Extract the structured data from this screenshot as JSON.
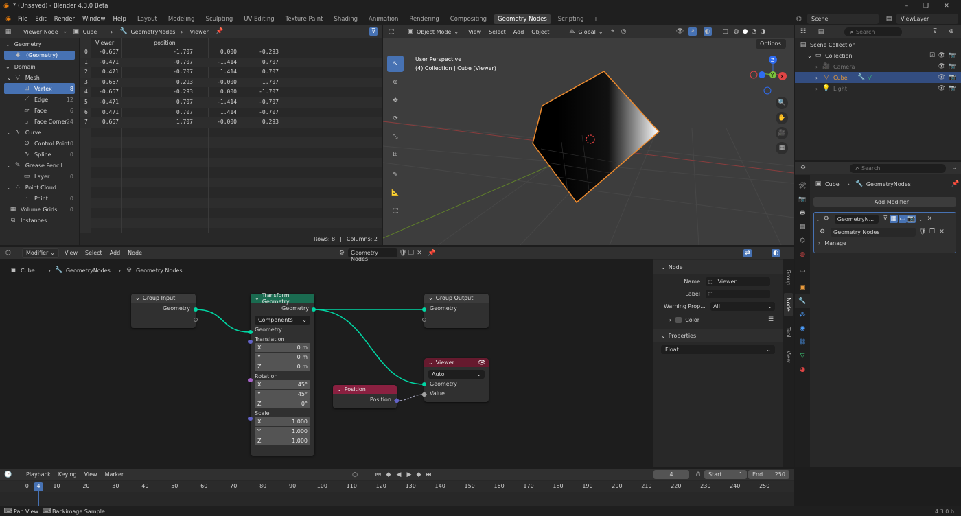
{
  "titlebar": {
    "title": "* (Unsaved) - Blender 4.3.0 Beta"
  },
  "menubar": {
    "items": [
      "File",
      "Edit",
      "Render",
      "Window",
      "Help"
    ],
    "workspaces": [
      "Layout",
      "Modeling",
      "Sculpting",
      "UV Editing",
      "Texture Paint",
      "Shading",
      "Animation",
      "Rendering",
      "Compositing",
      "Geometry Nodes",
      "Scripting"
    ],
    "active_workspace": "Geometry Nodes",
    "add": "+",
    "scene": "Scene",
    "view_layer": "ViewLayer"
  },
  "spreadsheet": {
    "mode": "Viewer Node",
    "object": "Cube",
    "modifier": "GeometryNodes",
    "viewer": "Viewer",
    "geometry_label": "Geometry",
    "geometry_item": "(Geometry)",
    "domain_label": "Domain",
    "domains": [
      {
        "label": "Mesh",
        "count": ""
      },
      {
        "label": "Vertex",
        "count": "8"
      },
      {
        "label": "Edge",
        "count": "12"
      },
      {
        "label": "Face",
        "count": "6"
      },
      {
        "label": "Face Corner",
        "count": "24"
      },
      {
        "label": "Curve",
        "count": ""
      },
      {
        "label": "Control Point",
        "count": "0"
      },
      {
        "label": "Spline",
        "count": "0"
      },
      {
        "label": "Grease Pencil",
        "count": ""
      },
      {
        "label": "Layer",
        "count": "0"
      },
      {
        "label": "Point Cloud",
        "count": ""
      },
      {
        "label": "Point",
        "count": "0"
      },
      {
        "label": "Volume Grids",
        "count": "0"
      },
      {
        "label": "Instances",
        "count": ""
      }
    ],
    "col_viewer": "Viewer",
    "col_position": "position",
    "rows": [
      {
        "i": "0",
        "v": "-0.667",
        "x": "-1.707",
        "y": "0.000",
        "z": "-0.293"
      },
      {
        "i": "1",
        "v": "-0.471",
        "x": "-0.707",
        "y": "-1.414",
        "z": "0.707"
      },
      {
        "i": "2",
        "v": "0.471",
        "x": "-0.707",
        "y": "1.414",
        "z": "0.707"
      },
      {
        "i": "3",
        "v": "0.667",
        "x": "0.293",
        "y": "-0.000",
        "z": "1.707"
      },
      {
        "i": "4",
        "v": "-0.667",
        "x": "-0.293",
        "y": "0.000",
        "z": "-1.707"
      },
      {
        "i": "5",
        "v": "-0.471",
        "x": "0.707",
        "y": "-1.414",
        "z": "-0.707"
      },
      {
        "i": "6",
        "v": "0.471",
        "x": "0.707",
        "y": "1.414",
        "z": "-0.707"
      },
      {
        "i": "7",
        "v": "0.667",
        "x": "1.707",
        "y": "-0.000",
        "z": "0.293"
      }
    ],
    "rows_status": "Rows: 8",
    "cols_status": "Columns: 2"
  },
  "viewport": {
    "mode": "Object Mode",
    "menus": [
      "View",
      "Select",
      "Add",
      "Object"
    ],
    "orientation": "Global",
    "options": "Options",
    "line1": "User Perspective",
    "line2": "(4) Collection | Cube (Viewer)",
    "gizmo": {
      "x": "X",
      "y": "Y",
      "z": "Z"
    }
  },
  "outliner": {
    "search_placeholder": "Search",
    "items": [
      {
        "label": "Scene Collection"
      },
      {
        "label": "Collection"
      },
      {
        "label": "Camera"
      },
      {
        "label": "Cube"
      },
      {
        "label": "Light"
      }
    ]
  },
  "properties": {
    "search_placeholder": "Search",
    "obj": "Cube",
    "mod": "GeometryNodes",
    "add_modifier": "Add Modifier",
    "modifier_name": "GeometryN...",
    "node_group": "Geometry Nodes",
    "manage": "Manage"
  },
  "node_editor": {
    "type": "Modifier",
    "menus": [
      "View",
      "Select",
      "Add",
      "Node"
    ],
    "group": "Geometry Nodes",
    "breadcrumb": [
      "Cube",
      "GeometryNodes",
      "Geometry Nodes"
    ],
    "nodes": {
      "group_input": {
        "title": "Group Input",
        "out": "Geometry"
      },
      "transform": {
        "title": "Transform Geometry",
        "out": "Geometry",
        "mode": "Components",
        "in_geo": "Geometry",
        "translation": "Translation",
        "tx": "0 m",
        "ty": "0 m",
        "tz": "0 m",
        "rotation": "Rotation",
        "rx": "45°",
        "ry": "45°",
        "rz": "0°",
        "scale": "Scale",
        "sx": "1.000",
        "sy": "1.000",
        "sz": "1.000",
        "X": "X",
        "Y": "Y",
        "Z": "Z"
      },
      "group_output": {
        "title": "Group Output",
        "in": "Geometry"
      },
      "viewer": {
        "title": "Viewer",
        "domain": "Auto",
        "in_geo": "Geometry",
        "in_val": "Value"
      },
      "position": {
        "title": "Position",
        "out": "Position"
      }
    },
    "sidebar": {
      "node_header": "Node",
      "name_label": "Name",
      "name_value": "Viewer",
      "label_label": "Label",
      "label_value": "",
      "warning_label": "Warning Prop...",
      "warning_value": "All",
      "color_label": "Color",
      "properties_header": "Properties",
      "type_value": "Float",
      "tabs": [
        "Group",
        "Node",
        "Tool",
        "View"
      ]
    }
  },
  "timeline": {
    "menus": [
      "Playback",
      "Keying",
      "View",
      "Marker"
    ],
    "current": "4",
    "start_label": "Start",
    "start": "1",
    "end_label": "End",
    "end": "250",
    "ticks": [
      "0",
      "10",
      "20",
      "30",
      "40",
      "50",
      "60",
      "70",
      "80",
      "90",
      "100",
      "110",
      "120",
      "130",
      "140",
      "150",
      "160",
      "170",
      "180",
      "190",
      "200",
      "210",
      "220",
      "230",
      "240",
      "250"
    ]
  },
  "statusbar": {
    "left1": "Pan View",
    "left2": "Backimage Sample",
    "version": "4.3.0 b"
  },
  "colors": {
    "accent": "#4772b3",
    "geo_socket": "#00d6a3",
    "vec_socket": "#6363c7",
    "rot_socket": "#a663c7",
    "val_socket": "#a1a1a1",
    "transform_head": "#1a6b50",
    "viewer_head": "#661a2e",
    "position_head": "#8a2040",
    "selection": "#ed8a2d"
  }
}
